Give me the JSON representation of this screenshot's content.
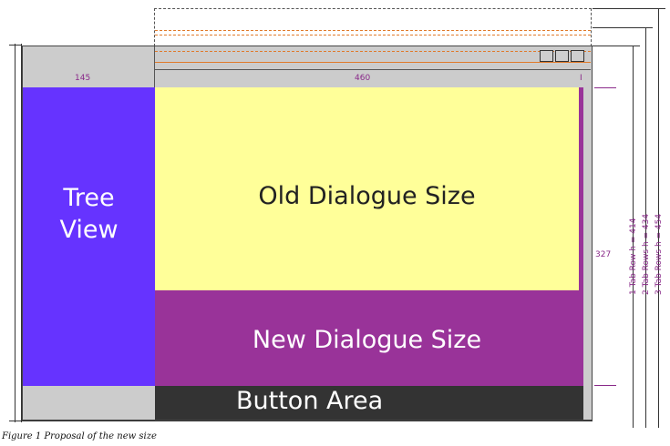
{
  "widths": {
    "tree": "145",
    "content": "460",
    "scrollbar": "I"
  },
  "heights": {
    "content": "327",
    "one_tab_row": "1 Tab Row  h = 414",
    "two_tab_rows": "2 Tab Rows h = 434",
    "three_tab_rows": "3 Tab Rows h = 454"
  },
  "areas": {
    "tree_line1": "Tree",
    "tree_line2": "View",
    "old_dialog": "Old Dialogue Size",
    "new_dialog": "New Dialogue Size",
    "button_area": "Button Area"
  },
  "caption": "Figure 1 Proposal of the new size",
  "colors": {
    "tree": "#6633ff",
    "old_dialog": "#ffff99",
    "new_dialog": "#993399",
    "button_area": "#333333",
    "frame": "#cccccc",
    "dimension_text": "#8a2a8a"
  }
}
